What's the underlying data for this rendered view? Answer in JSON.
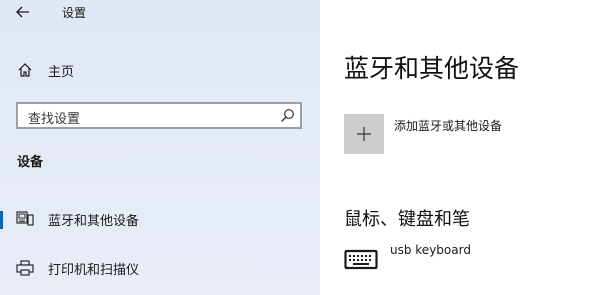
{
  "window": {
    "title": "设置"
  },
  "sidebar": {
    "home_label": "主页",
    "search_placeholder": "查找设置",
    "section_header": "设备",
    "items": [
      {
        "label": "蓝牙和其他设备",
        "icon": "bluetooth-devices-icon",
        "selected": true
      },
      {
        "label": "打印机和扫描仪",
        "icon": "printer-icon",
        "selected": false
      }
    ]
  },
  "main": {
    "title": "蓝牙和其他设备",
    "add_device_label": "添加蓝牙或其他设备",
    "mouse_section_title": "鼠标、键盘和笔",
    "devices": [
      {
        "name": "usb keyboard",
        "icon": "keyboard-icon"
      }
    ]
  },
  "colors": {
    "accent": "#0067c0",
    "sidebar_bg": "#e4eaf6",
    "add_tile_bg": "#cccccc"
  }
}
